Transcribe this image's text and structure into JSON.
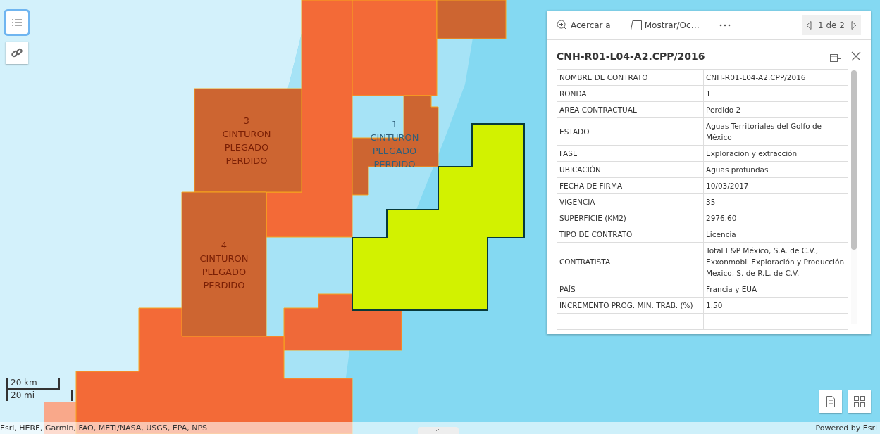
{
  "map": {
    "labels": [
      {
        "number": "3",
        "name": "CINTURON PLEGADO PERDIDO",
        "color": "#7a1f05"
      },
      {
        "number": "1",
        "name": "CINTURON PLEGADO PERDIDO",
        "color": "#2f5f7a"
      },
      {
        "number": "4",
        "name": "CINTURON PLEGADO PERDIDO",
        "color": "#7a1f05"
      }
    ],
    "scale": {
      "metric": "20 km",
      "imperial": "20 mi"
    },
    "attribution": "Esri, HERE, Garmin, FAO, METI/NASA, USGS, EPA, NPS",
    "powered_by": "Powered by Esri"
  },
  "popup": {
    "actions": [
      {
        "label": "Acercar a",
        "kind": "zoom"
      },
      {
        "label": "Mostrar/Oc…",
        "kind": "toggle"
      }
    ],
    "pager": "1 de 2",
    "title": "CNH-R01-L04-A2.CPP/2016",
    "rows": [
      {
        "field": "NOMBRE DE CONTRATO",
        "value": "CNH-R01-L04-A2.CPP/2016"
      },
      {
        "field": "RONDA",
        "value": "1"
      },
      {
        "field": "ÁREA CONTRACTUAL",
        "value": "Perdido 2"
      },
      {
        "field": "ESTADO",
        "value": "Aguas Territoriales del Golfo de México"
      },
      {
        "field": "FASE",
        "value": "Exploración y extracción"
      },
      {
        "field": "UBICACIÓN",
        "value": "Aguas profundas"
      },
      {
        "field": "FECHA DE FIRMA",
        "value": "10/03/2017"
      },
      {
        "field": "VIGENCIA",
        "value": "35"
      },
      {
        "field": "SUPERFICIE (KM2)",
        "value": "2976.60"
      },
      {
        "field": "TIPO DE CONTRATO",
        "value": "Licencia"
      },
      {
        "field": "CONTRATISTA",
        "value": "Total E&P México, S.A. de C.V., Exxonmobil Exploración y Producción Mexico, S. de R.L. de C.V."
      },
      {
        "field": "PAÍS",
        "value": "Francia y EUA"
      },
      {
        "field": "INCREMENTO PROG. MIN. TRAB. (%)",
        "value": "1.50"
      }
    ]
  }
}
